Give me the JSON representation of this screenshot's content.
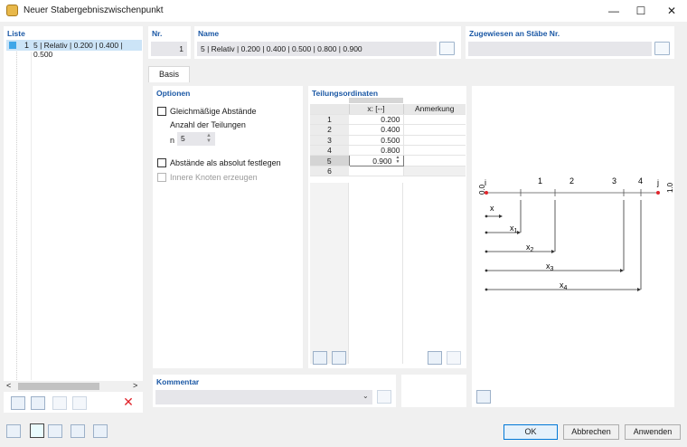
{
  "window": {
    "title": "Neuer Stabergebniszwischenpunkt",
    "minimize": "—",
    "maximize": "☐",
    "close": "✕"
  },
  "list": {
    "title": "Liste",
    "items": [
      {
        "num": "1",
        "text": "5 | Relativ | 0.200 | 0.400 | 0.500"
      }
    ],
    "scroll_left": "<",
    "scroll_right": ">"
  },
  "nr": {
    "label": "Nr.",
    "value": "1"
  },
  "name": {
    "label": "Name",
    "value": "5 | Relativ | 0.200 | 0.400 | 0.500 | 0.800 | 0.900"
  },
  "assigned": {
    "label": "Zugewiesen an Stäbe Nr.",
    "value": ""
  },
  "tabs": [
    {
      "label": "Basis"
    }
  ],
  "options": {
    "title": "Optionen",
    "equal_spacing": "Gleichmäßige Abstände",
    "num_divisions_label": "Anzahl der Teilungen",
    "n_label": "n",
    "n_value": "5",
    "absolute": "Abstände als absolut festlegen",
    "inner_nodes": "Innere Knoten erzeugen"
  },
  "division": {
    "title": "Teilungsordinaten",
    "col_x": "x: [--]",
    "col_note": "Anmerkung",
    "rows": [
      {
        "n": "1",
        "x": "0.200",
        "note": ""
      },
      {
        "n": "2",
        "x": "0.400",
        "note": ""
      },
      {
        "n": "3",
        "x": "0.500",
        "note": ""
      },
      {
        "n": "4",
        "x": "0.800",
        "note": ""
      },
      {
        "n": "5",
        "x": "0.900",
        "note": ""
      },
      {
        "n": "6",
        "x": "",
        "note": ""
      }
    ]
  },
  "diagram": {
    "start": "i",
    "end": "j",
    "start_value": "0.0",
    "end_value": "1.0",
    "ticks": [
      "1",
      "2",
      "3",
      "4"
    ],
    "x_label": "x",
    "dims": [
      "x",
      "x",
      "x",
      "x"
    ],
    "subs": [
      "1",
      "2",
      "3",
      "4"
    ],
    "positions": [
      0.2,
      0.4,
      0.5,
      0.8,
      0.9
    ]
  },
  "comment": {
    "label": "Kommentar",
    "value": ""
  },
  "buttons": {
    "ok": "OK",
    "cancel": "Abbrechen",
    "apply": "Anwenden"
  },
  "colors": {
    "accent": "#1b58a5",
    "selection": "#cce4f7",
    "node": "#e0242b"
  }
}
